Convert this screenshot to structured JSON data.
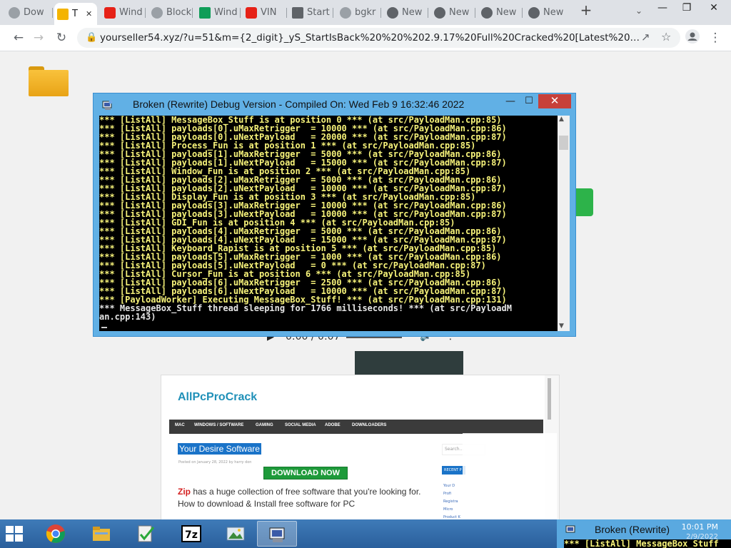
{
  "browser": {
    "tabs": [
      {
        "label": "Dow",
        "active": false,
        "icon": "chrome-icon"
      },
      {
        "label": "T",
        "active": true,
        "icon": "folder-icon"
      },
      {
        "label": "Wind",
        "active": false,
        "icon": "youtube-icon"
      },
      {
        "label": "Block",
        "active": false,
        "icon": "chrome-icon"
      },
      {
        "label": "Wind",
        "active": false,
        "icon": "sheets-icon"
      },
      {
        "label": "VIN",
        "active": false,
        "icon": "youtube-icon"
      },
      {
        "label": "Start",
        "active": false,
        "icon": "window-icon"
      },
      {
        "label": "bgkr",
        "active": false,
        "icon": "chrome-icon"
      },
      {
        "label": "New",
        "active": false,
        "icon": "chrome-icon"
      },
      {
        "label": "New",
        "active": false,
        "icon": "chrome-icon"
      },
      {
        "label": "New",
        "active": false,
        "icon": "chrome-icon"
      },
      {
        "label": "New",
        "active": false,
        "icon": "chrome-icon"
      }
    ],
    "new_tab": "+",
    "tab_search": "⌄",
    "window_controls": {
      "minimize": "—",
      "maximize": "❐",
      "close": "✕"
    },
    "url": "yourseller54.xyz/?u=51&m={2_digit}_yS_StartIsBack%20%20%202.9.17%20Full%20Cracked%20[Latest%20Version]&D..."
  },
  "debug_window": {
    "title": "Broken (Rewrite) Debug Version - Compiled On: Wed Feb  9 16:32:46 2022",
    "minimize": "—",
    "maximize": "☐",
    "close": "✕",
    "lines": [
      {
        "text": "*** [ListAll] MessageBox_Stuff is at position 0 *** (at src/PayloadMan.cpp:85)",
        "white": false
      },
      {
        "text": "*** [ListAll] payloads[0].uMaxRetrigger  = 10000 *** (at src/PayloadMan.cpp:86)",
        "white": false
      },
      {
        "text": "*** [ListAll] payloads[0].uNextPayload   = 20000 *** (at src/PayloadMan.cpp:87)",
        "white": false
      },
      {
        "text": "*** [ListAll] Process_Fun is at position 1 *** (at src/PayloadMan.cpp:85)",
        "white": false
      },
      {
        "text": "*** [ListAll] payloads[1].uMaxRetrigger  = 5000 *** (at src/PayloadMan.cpp:86)",
        "white": false
      },
      {
        "text": "*** [ListAll] payloads[1].uNextPayload   = 15000 *** (at src/PayloadMan.cpp:87)",
        "white": false
      },
      {
        "text": "*** [ListAll] Window_Fun is at position 2 *** (at src/PayloadMan.cpp:85)",
        "white": false
      },
      {
        "text": "*** [ListAll] payloads[2].uMaxRetrigger  = 5000 *** (at src/PayloadMan.cpp:86)",
        "white": false
      },
      {
        "text": "*** [ListAll] payloads[2].uNextPayload   = 10000 *** (at src/PayloadMan.cpp:87)",
        "white": false
      },
      {
        "text": "*** [ListAll] Display_Fun is at position 3 *** (at src/PayloadMan.cpp:85)",
        "white": false
      },
      {
        "text": "*** [ListAll] payloads[3].uMaxRetrigger  = 10000 *** (at src/PayloadMan.cpp:86)",
        "white": false
      },
      {
        "text": "*** [ListAll] payloads[3].uNextPayload   = 10000 *** (at src/PayloadMan.cpp:87)",
        "white": false
      },
      {
        "text": "*** [ListAll] GDI_Fun is at position 4 *** (at src/PayloadMan.cpp:85)",
        "white": false
      },
      {
        "text": "*** [ListAll] payloads[4].uMaxRetrigger  = 5000 *** (at src/PayloadMan.cpp:86)",
        "white": false
      },
      {
        "text": "*** [ListAll] payloads[4].uNextPayload   = 15000 *** (at src/PayloadMan.cpp:87)",
        "white": false
      },
      {
        "text": "*** [ListAll] Keyboard_Rapist is at position 5 *** (at src/PayloadMan.cpp:85)",
        "white": false
      },
      {
        "text": "*** [ListAll] payloads[5].uMaxRetrigger  = 1000 *** (at src/PayloadMan.cpp:86)",
        "white": false
      },
      {
        "text": "*** [ListAll] payloads[5].uNextPayload   = 0 *** (at src/PayloadMan.cpp:87)",
        "white": false
      },
      {
        "text": "*** [ListAll] Cursor_Fun is at position 6 *** (at src/PayloadMan.cpp:85)",
        "white": false
      },
      {
        "text": "*** [ListAll] payloads[6].uMaxRetrigger  = 2500 *** (at src/PayloadMan.cpp:86)",
        "white": false
      },
      {
        "text": "*** [ListAll] payloads[6].uNextPayload   = 10000 *** (at src/PayloadMan.cpp:87)",
        "white": false
      },
      {
        "text": "*** [PayloadWorker] Executing MessageBox_Stuff! *** (at src/PayloadMan.cpp:131)",
        "white": false
      },
      {
        "text": "*** MessageBox_Stuff thread sleeping for 1766 milliseconds! *** (at src/PayloadM",
        "white": true
      },
      {
        "text": "an.cpp:143)",
        "white": true
      }
    ]
  },
  "audio_player": {
    "time": "0:00 / 0:07"
  },
  "site_screenshot": {
    "logo": "AllPcProCrack",
    "nav": [
      "MAC",
      "WINDOWS / SOFTWARE",
      "GAMING",
      "SOCIAL MEDIA",
      "ADOBE",
      "DOWNLOADERS"
    ],
    "post_title": "Your Desire Software",
    "meta": "Posted on January 28, 2022 by harry don",
    "download_button": "DOWNLOAD NOW",
    "paragraph_brand": "Zip",
    "paragraph": " has a huge collection of free software that you're looking for. How to download & Install free software for PC",
    "search_placeholder": "Search...",
    "recent_label": "RECENT P",
    "sidebar_links": [
      "Your D",
      "Profi",
      "Registra",
      "Micro",
      "Product K"
    ]
  },
  "taskbar": {
    "thumbnail_title": "Broken (Rewrite)",
    "thumbnail_console": "*** [ListAll] MessageBox_Stuff",
    "time": "10:01 PM",
    "date": "2/9/2022",
    "apps": [
      "chrome",
      "file-explorer",
      "checklist",
      "7zip",
      "photo-viewer",
      "broken-app"
    ]
  }
}
